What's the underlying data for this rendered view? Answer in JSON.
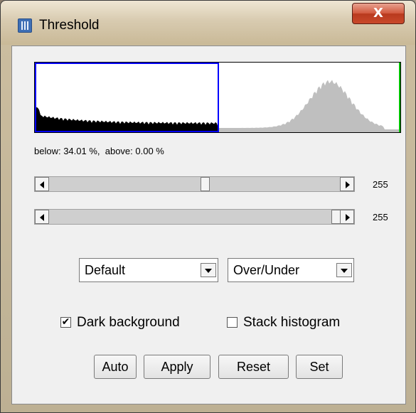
{
  "window": {
    "title": "Threshold",
    "close_label": "X"
  },
  "histogram": {
    "status": "below: 34.01 %,  above: 0.00 %",
    "threshold_color": "#0000ff",
    "upper_color": "#00c000",
    "histogram_color": "#000000",
    "histogram_outside_color": "#bfbfbf"
  },
  "sliders": [
    {
      "value": "255",
      "position_fraction": 0.51
    },
    {
      "value": "255",
      "position_fraction": 1.0
    }
  ],
  "method_select": {
    "value": "Default"
  },
  "display_select": {
    "value": "Over/Under"
  },
  "checkboxes": {
    "dark_background": {
      "label": "Dark background",
      "checked": true,
      "mark": "✔"
    },
    "stack_histogram": {
      "label": "Stack histogram",
      "checked": false,
      "mark": ""
    }
  },
  "buttons": {
    "auto": "Auto",
    "apply": "Apply",
    "reset": "Reset",
    "set": "Set"
  }
}
